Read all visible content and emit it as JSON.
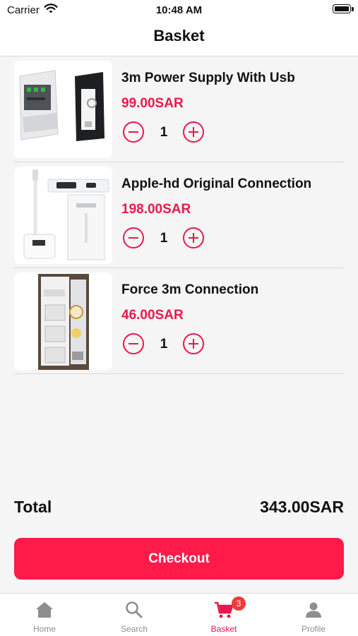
{
  "status_bar": {
    "carrier": "Carrier",
    "time": "10:48 AM"
  },
  "header": {
    "title": "Basket"
  },
  "items": [
    {
      "name": "3m Power Supply With Usb",
      "price": "99.00SAR",
      "quantity": "1"
    },
    {
      "name": "Apple-hd Original Connection",
      "price": "198.00SAR",
      "quantity": "1"
    },
    {
      "name": "Force 3m Connection",
      "price": "46.00SAR",
      "quantity": "1"
    }
  ],
  "summary": {
    "total_label": "Total",
    "total_value": "343.00SAR"
  },
  "checkout_label": "Checkout",
  "tabs": [
    {
      "label": "Home",
      "icon": "home-icon"
    },
    {
      "label": "Search",
      "icon": "search-icon"
    },
    {
      "label": "Basket",
      "icon": "cart-icon",
      "badge": "3"
    },
    {
      "label": "Profile",
      "icon": "person-icon"
    }
  ],
  "colors": {
    "accent": "#e8194a",
    "checkout": "#ff1a4a",
    "inactive_tab": "#8e8e8e"
  }
}
